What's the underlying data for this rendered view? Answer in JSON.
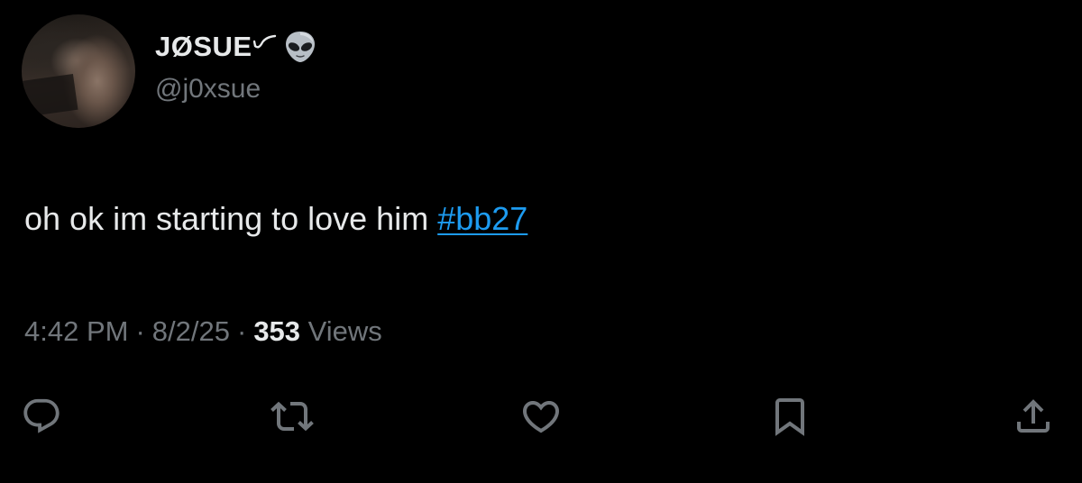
{
  "tweet": {
    "author": {
      "display_name": "JØSUE",
      "handle": "@j0xsue",
      "badge_icon": "alien-emoji-icon"
    },
    "text": "oh ok im starting to love him ",
    "hashtag": "#bb27",
    "meta": {
      "time": "4:42 PM",
      "separator": "·",
      "date": "8/2/25",
      "views_count": "353",
      "views_label": "Views"
    },
    "actions": [
      {
        "name": "reply",
        "icon": "reply-icon"
      },
      {
        "name": "retweet",
        "icon": "retweet-icon"
      },
      {
        "name": "like",
        "icon": "heart-icon"
      },
      {
        "name": "bookmark",
        "icon": "bookmark-icon"
      },
      {
        "name": "share",
        "icon": "share-icon"
      }
    ]
  },
  "colors": {
    "background": "#000000",
    "primary_text": "#e7e9ea",
    "secondary_text": "#71767b",
    "link": "#1d9bf0"
  }
}
